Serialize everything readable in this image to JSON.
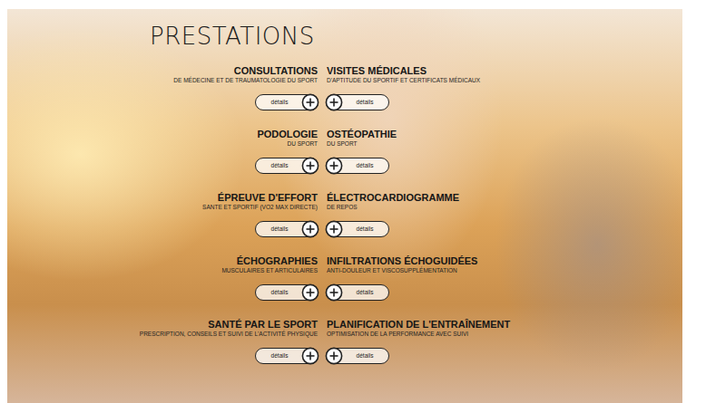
{
  "title": "PRESTATIONS",
  "rows": [
    {
      "left": {
        "title": "CONSULTATIONS",
        "subtitle": "DE MÉDECINE ET DE TRAUMATOLOGIE DU SPORT",
        "button": "détails"
      },
      "right": {
        "title": "VISITES MÉDICALES",
        "subtitle": "D'APTITUDE DU SPORTIF ET CERTIFICATS MÉDICAUX",
        "button": "détails"
      }
    },
    {
      "left": {
        "title": "PODOLOGIE",
        "subtitle": "DU SPORT",
        "button": "détails"
      },
      "right": {
        "title": "OSTÉOPATHIE",
        "subtitle": "DU SPORT",
        "button": "détails"
      }
    },
    {
      "left": {
        "title": "ÉPREUVE D'EFFORT",
        "subtitle": "SANTE ET SPORTIF (VO2 MAX DIRECTE)",
        "button": "détails"
      },
      "right": {
        "title": "ÉLECTROCARDIOGRAMME",
        "subtitle": "DE REPOS",
        "button": "détails"
      }
    },
    {
      "left": {
        "title": "ÉCHOGRAPHIES",
        "subtitle": "MUSCULAIRES ET ARTICULAIRES",
        "button": "détails"
      },
      "right": {
        "title": "INFILTRATIONS ÉCHOGUIDÉES",
        "subtitle": "ANTI-DOULEUR ET VISCOSUPPLÉMENTATION",
        "button": "détails"
      }
    },
    {
      "left": {
        "title": "SANTÉ PAR LE SPORT",
        "subtitle": "PRESCRIPTION, CONSEILS ET SUIVI DE L'ACTIVITÉ PHYSIQUE",
        "button": "détails"
      },
      "right": {
        "title": "PLANIFICATION DE L'ENTRAÎNEMENT",
        "subtitle": "OPTIMISATION DE LA PERFORMANCE AVEC SUIVI",
        "button": "détails"
      }
    }
  ]
}
